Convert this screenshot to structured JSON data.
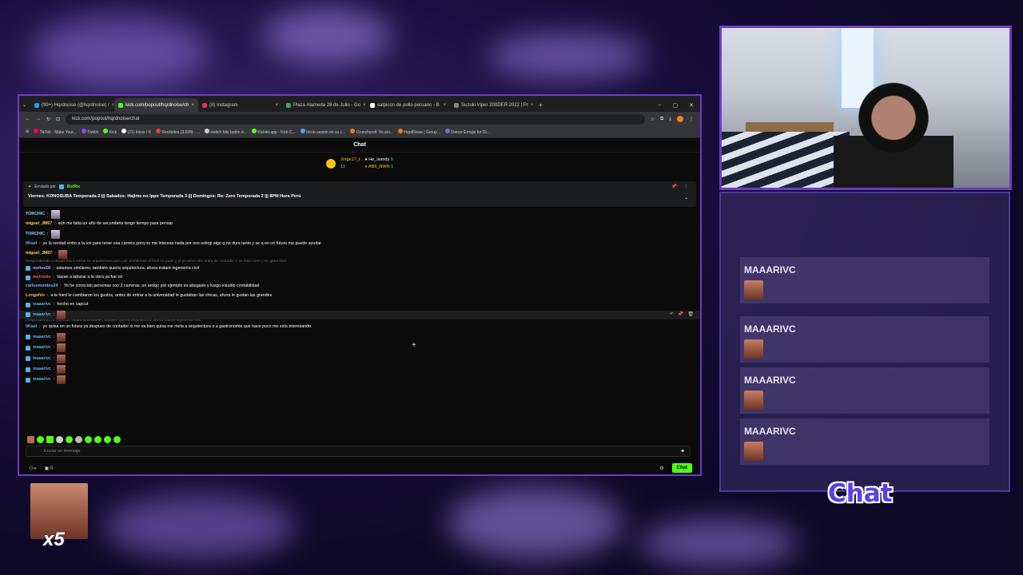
{
  "browser": {
    "tabs": [
      {
        "title": "(99+) Hqrdnoise (@hqrdnoise) /",
        "color": "#1d9bf0",
        "active": false
      },
      {
        "title": "kick.com/popout/hqrdnoise/ch",
        "color": "#53fc18",
        "active": true
      },
      {
        "title": "(8) Instagram",
        "color": "#e1306c",
        "active": false
      },
      {
        "title": "Plaza Alameda 28 de Julio - Go",
        "color": "#34a853",
        "active": false
      },
      {
        "title": "salpicon de pollo peruano - B",
        "color": "#ffffff",
        "active": false
      },
      {
        "title": "Suzuki Viper 200DER 2022 | Pr",
        "color": "#888888",
        "active": false
      }
    ],
    "url": "kick.com/popout/hqrdnoise/chat",
    "bookmarks": [
      "TikTok - Make Your...",
      "Twitch",
      "Kick",
      "(21) Inicio / X",
      "Recibidos (3,628) - ...",
      "switch bits botón d...",
      "Kicklet.app - Kick C...",
      "Inicie sesión en su c...",
      "Crunchyroll: Ve ani...",
      "HqrdNoise | Group...",
      "Dance Emojis for Di..."
    ]
  },
  "chat": {
    "header": "Chat",
    "leaderboard": [
      {
        "name": "Jorge17_t",
        "count": "10"
      },
      {
        "name": "He_isandy",
        "count": "5"
      },
      {
        "name": "ABII_NWN",
        "count": "1"
      }
    ],
    "pinned": {
      "by_label": "Enviado por",
      "by_user": "BotRix",
      "message": "Viernes: KONOSUBA Temporada 2 ||| Sabados: Hajime no Ippo Temporada 3 ||| Domingos: Re: Zero Temporada 2 ||| 8PM Hora Perú"
    },
    "messages": [
      {
        "user": "TORCHIC",
        "color": "#8ad3ff",
        "text": "",
        "emote": "sm"
      },
      {
        "user": "miguel_JM07",
        "color": "#ffd65c",
        "text": "aún me falta un año de secundaria tengo tiempo para pensar"
      },
      {
        "user": "TORCHIC",
        "color": "#8ad3ff",
        "text": "",
        "emote": "sm"
      },
      {
        "user": "0Kael",
        "color": "#66b2ff",
        "text": "yo la verdad entro a la uni para tener una carrera porq no me interesa nada por eso esfogi algo q no dura tanto y se q en un futuro me puede ayudar"
      },
      {
        "user": "miguel_JM07",
        "color": "#ffd65c",
        "text": "",
        "emote": "red"
      },
      {
        "reply": "Respondiendo a 0Kael: iba a entrar en arquitectura pero por problemas al final no pude y el proximo año entro de contador o se mas corto y se gana bien"
      },
      {
        "user": "norius18",
        "color": "#c7a4ff",
        "text": "estamos similares, también quería arquitectura, ahora trataré ingeniería civil"
      },
      {
        "user": "metronis",
        "color": "#ff5a5a",
        "text": "Vayan a laburar a la obra ya fue xd"
      },
      {
        "user": "carlosmontes24",
        "color": "#7fb0ff",
        "text": "Yo he conocido personas con 2 carreras, un amigo por ejemplo es abogado y luego estudio contabilidad"
      },
      {
        "user": "Longshin",
        "color": "#ffb05c",
        "text": "a la hard le cambiaron los gustos, antes de entrar a la universidad le gustaban las chicas, ahora le gustan las grandes"
      },
      {
        "user": "maaarivc",
        "color": "#53b3e8",
        "text": "hecho en capcut"
      },
      {
        "user": "maaarivc",
        "color": "#53b3e8",
        "text": "",
        "emote": "face"
      },
      {
        "reply": "Respondiendo a norius18: estamos similares, también quería arquitectura, ahora trataré ingeniería civil"
      },
      {
        "user": "0Kael",
        "color": "#66b2ff",
        "text": "yo quisa en un futura ya despues de contador si me va bien quisa me meta a arquitectura o a gastronomia que hace poco me esta interesando"
      },
      {
        "user": "maaarivc",
        "color": "#53b3e8",
        "text": "",
        "emote": "face"
      },
      {
        "user": "maaarivc",
        "color": "#53b3e8",
        "text": "",
        "emote": "face"
      },
      {
        "user": "maaarivc",
        "color": "#53b3e8",
        "text": "",
        "emote": "face"
      },
      {
        "user": "maaarivc",
        "color": "#53b3e8",
        "text": "",
        "emote": "face"
      },
      {
        "user": "maaarivc",
        "color": "#53b3e8",
        "text": "",
        "emote": "face"
      }
    ],
    "input_placeholder": "Enviar un mensaje",
    "footer_count": "0",
    "chat_button": "Chat"
  },
  "overlay": {
    "side_messages": [
      "MAAARIVC",
      "MAAARIVC",
      "MAAARIVC",
      "MAAARIVC"
    ],
    "side_title": "Chat",
    "combo_count": "x5"
  },
  "colors": {
    "accent": "#6c3cc8",
    "kick_green": "#53fc18"
  }
}
